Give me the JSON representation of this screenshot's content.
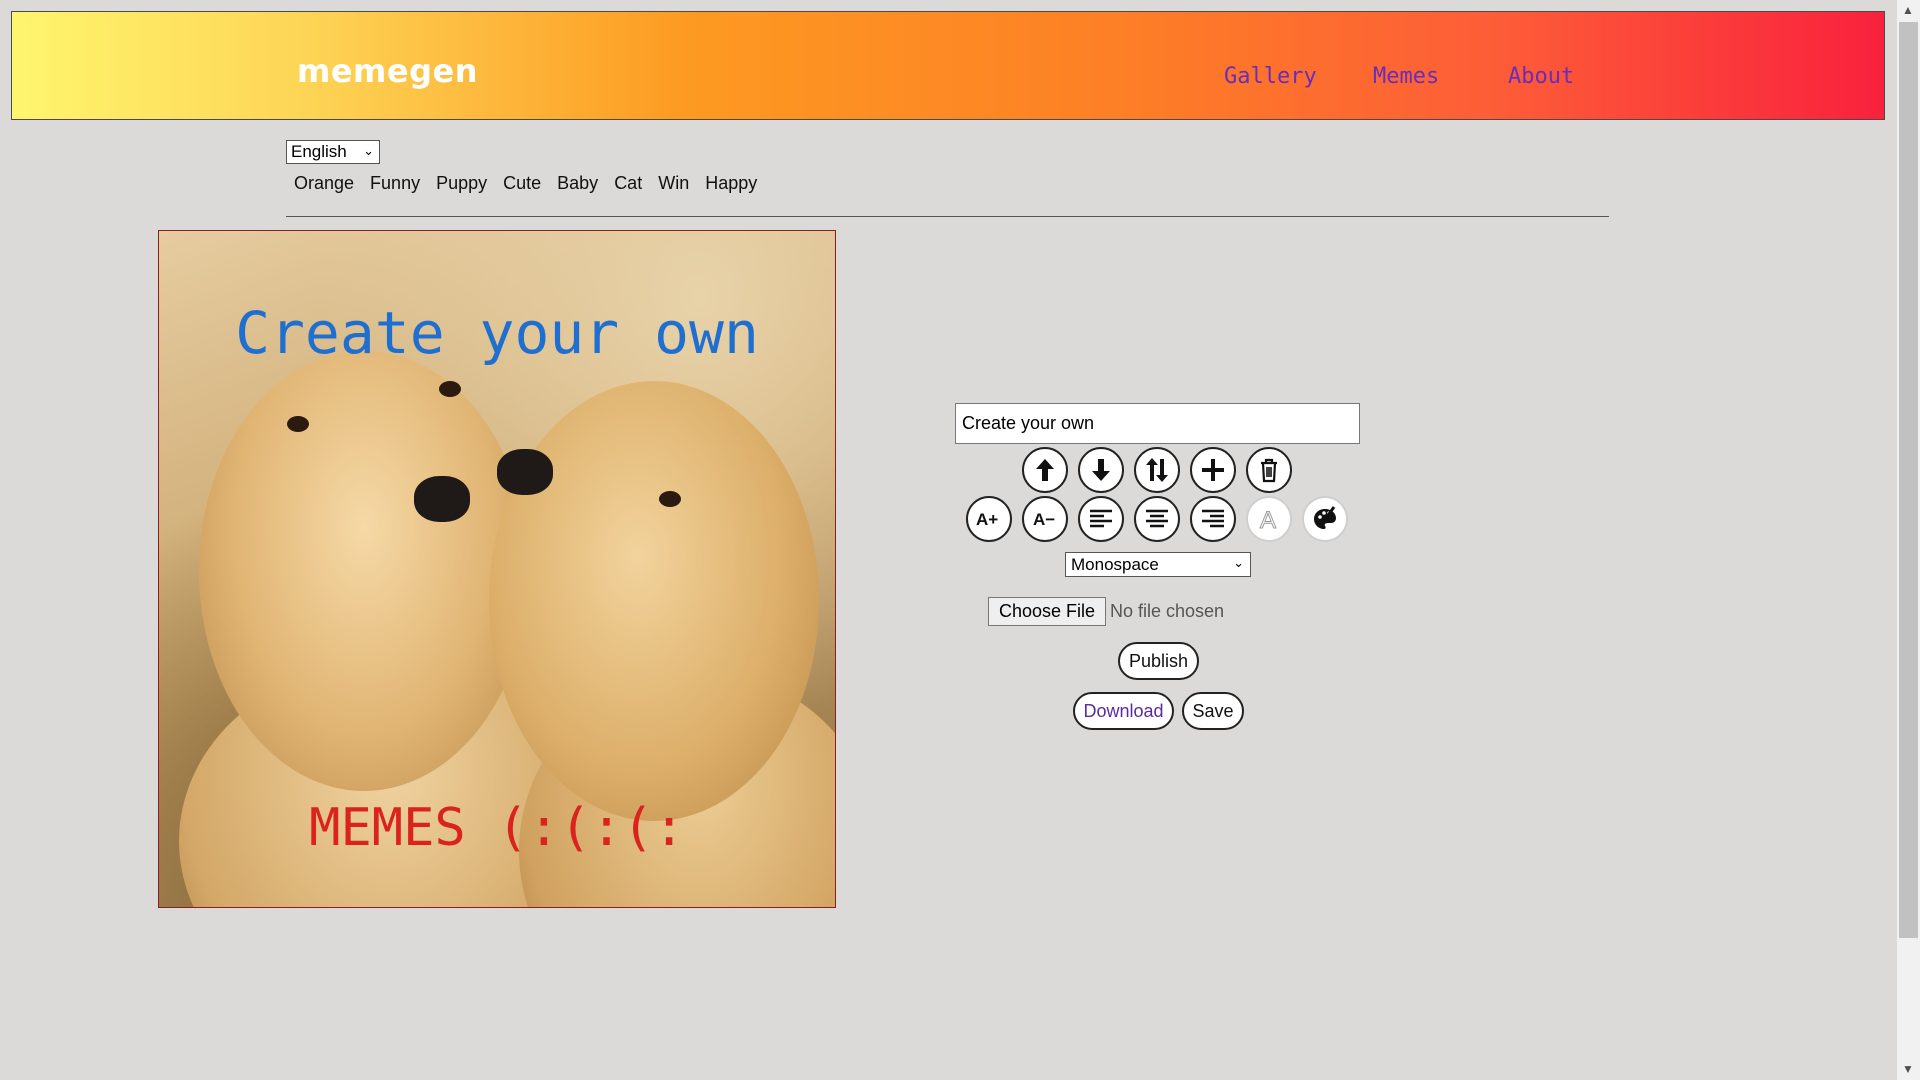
{
  "header": {
    "logo": "memegen",
    "nav": [
      "Gallery",
      "Memes",
      "About"
    ]
  },
  "language": {
    "selected": "English"
  },
  "tags": [
    "Orange",
    "Funny",
    "Puppy",
    "Cute",
    "Baby",
    "Cat",
    "Win",
    "Happy"
  ],
  "canvas": {
    "top_text": "Create your own",
    "bottom_text": "MEMES (:(:(:",
    "top_color": "#1f6fd0",
    "bottom_color": "#d9241e"
  },
  "editor": {
    "text_value": "Create your own",
    "font": "Monospace",
    "file_button": "Choose File",
    "file_status": "No file chosen",
    "publish": "Publish",
    "download": "Download",
    "save": "Save",
    "icons_row1": [
      "arrow-up-icon",
      "arrow-down-icon",
      "swap-vertical-icon",
      "plus-icon",
      "trash-icon"
    ],
    "icons_row2": [
      "font-increase-icon",
      "font-decrease-icon",
      "align-left-icon",
      "align-center-icon",
      "align-right-icon",
      "stroke-icon",
      "palette-icon"
    ]
  }
}
